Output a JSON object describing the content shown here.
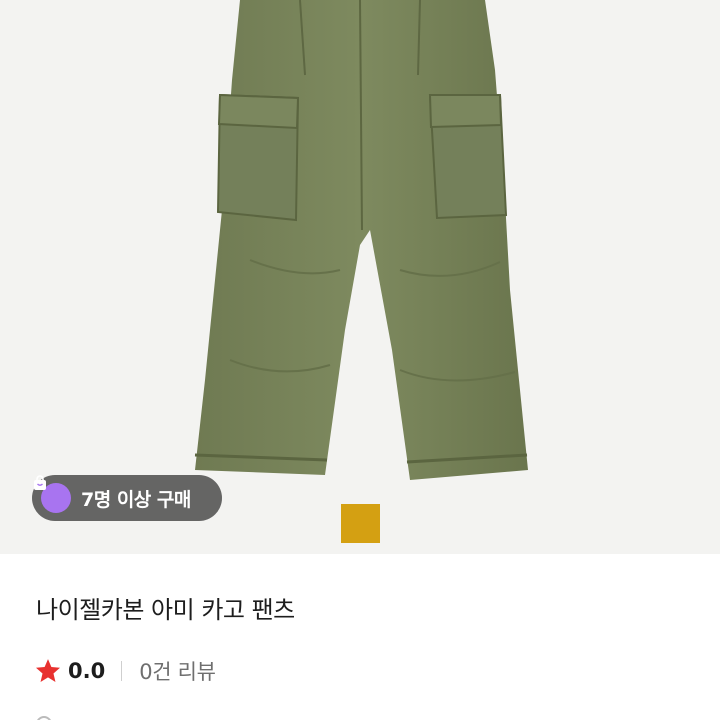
{
  "product": {
    "image_alt_icon": "cargo-pants-photo",
    "thumbnail_color": "#d4a012",
    "badge": {
      "icon": "shopping-bag-icon",
      "text": "7명 이상 구매",
      "icon_color": "#a874f0"
    },
    "title": "나이젤카본 아미 카고 팬츠",
    "rating": {
      "icon": "star-icon",
      "star_color": "#e8312f",
      "value": "0.0",
      "review_text": "0건 리뷰"
    }
  }
}
